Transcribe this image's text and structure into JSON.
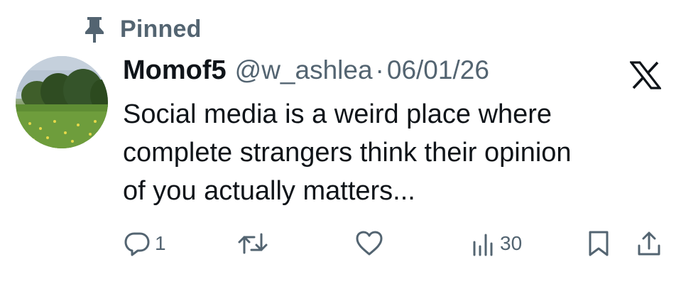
{
  "pinned": {
    "icon": "pin-icon",
    "label": "Pinned"
  },
  "author": {
    "display_name": "Momof5",
    "handle": "@w_ashlea",
    "separator": "·",
    "date": "06/01/26",
    "avatar": "avatar"
  },
  "tweet": {
    "lines": [
      "Social media is a weird place where",
      "complete strangers think their opinion",
      "of you actually matters..."
    ]
  },
  "actions": {
    "reply": {
      "icon": "reply-icon",
      "count": "1"
    },
    "repost": {
      "icon": "repost-icon",
      "count": ""
    },
    "like": {
      "icon": "heart-icon",
      "count": ""
    },
    "views": {
      "icon": "views-icon",
      "count": "30"
    },
    "bookmark": {
      "icon": "bookmark-icon"
    },
    "share": {
      "icon": "share-icon"
    }
  },
  "colors": {
    "text": "#0f1419",
    "muted": "#536471",
    "background": "#ffffff"
  }
}
